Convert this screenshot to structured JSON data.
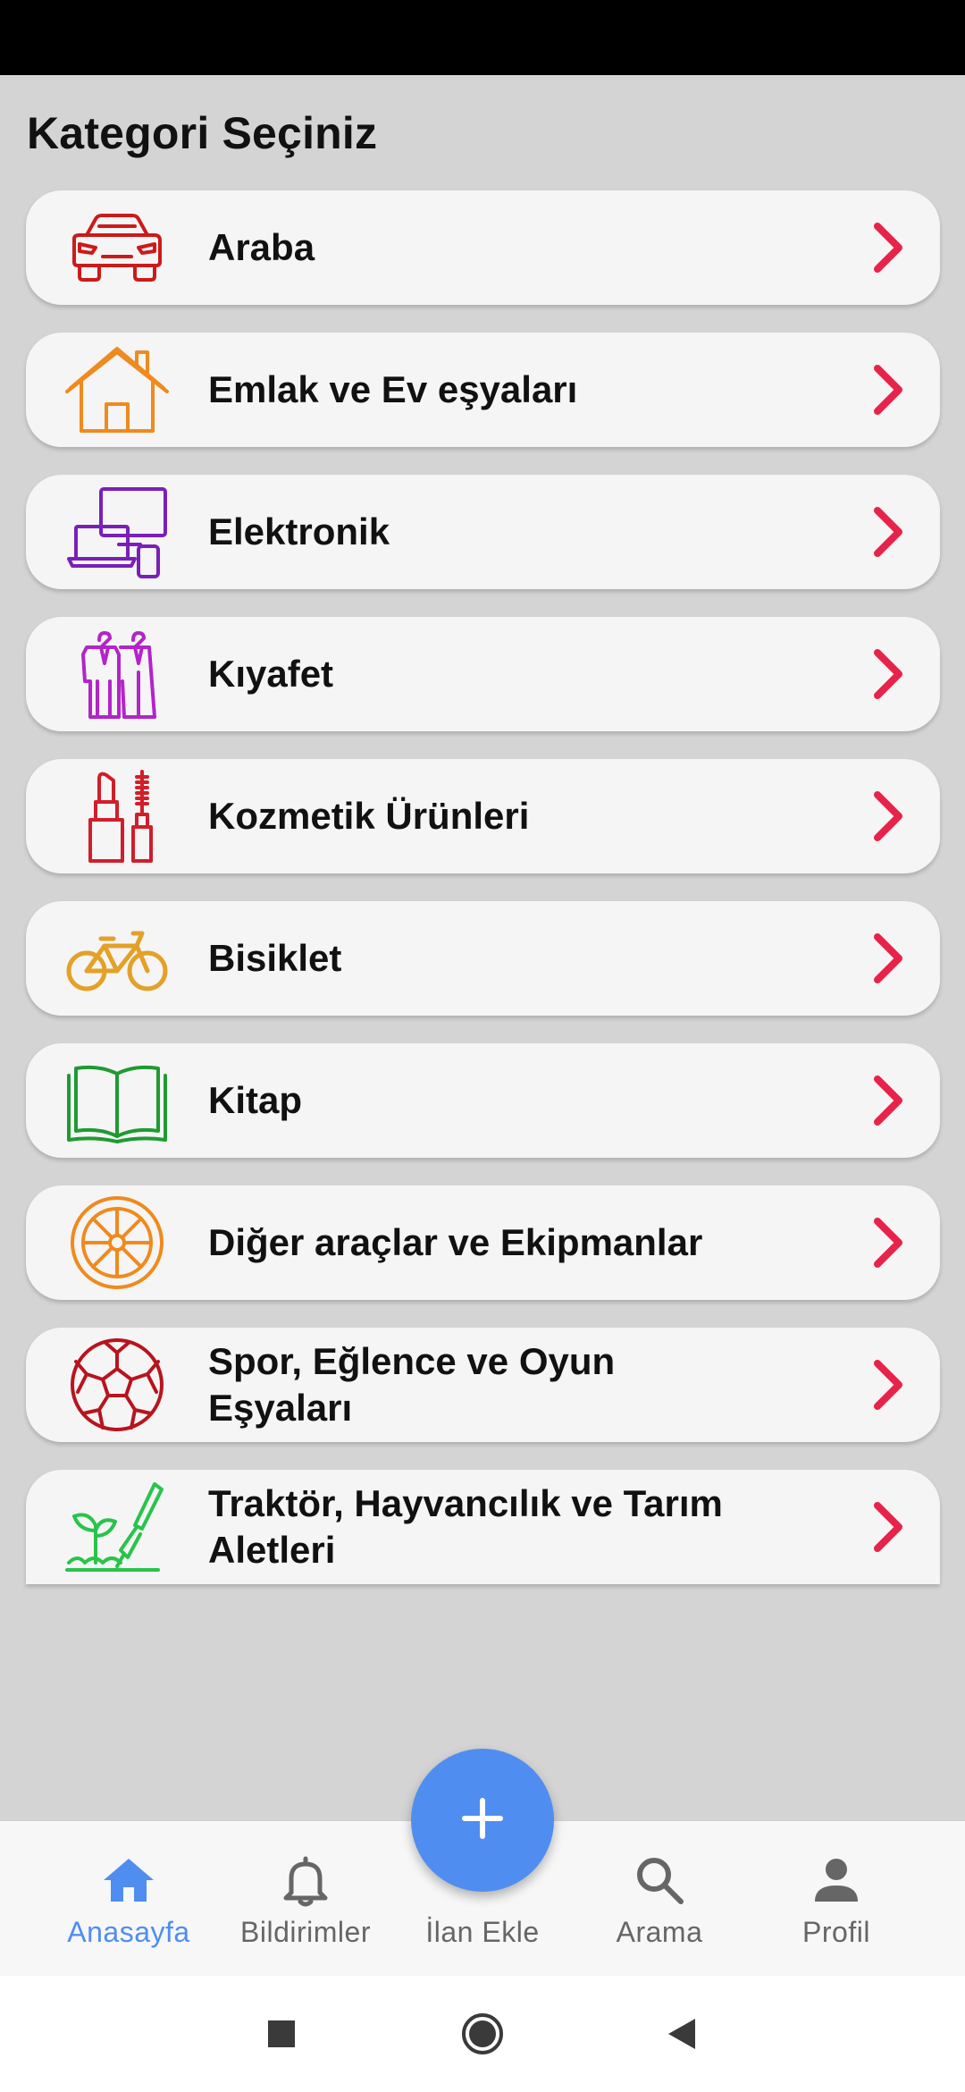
{
  "page": {
    "title": "Kategori Seçiniz"
  },
  "colors": {
    "chevron": "#e8234a",
    "accent": "#4f8ef0",
    "inactive": "#666666"
  },
  "categories": [
    {
      "label": "Araba",
      "icon": "car-icon",
      "color": "#cc1a1a"
    },
    {
      "label": "Emlak ve Ev eşyaları",
      "icon": "house-icon",
      "color": "#ef8a1e"
    },
    {
      "label": "Elektronik",
      "icon": "devices-icon",
      "color": "#7a1fb8"
    },
    {
      "label": "Kıyafet",
      "icon": "clothes-icon",
      "color": "#b324c9"
    },
    {
      "label": "Kozmetik Ürünleri",
      "icon": "cosmetics-icon",
      "color": "#d21e2a"
    },
    {
      "label": "Bisiklet",
      "icon": "bicycle-icon",
      "color": "#e3a128"
    },
    {
      "label": "Kitap",
      "icon": "book-icon",
      "color": "#1f9a32"
    },
    {
      "label": "Diğer araçlar ve Ekipmanlar",
      "icon": "wheel-icon",
      "color": "#ef8a1e"
    },
    {
      "label": "Spor, Eğlence ve Oyun Eşyaları",
      "icon": "football-icon",
      "color": "#b8141e"
    },
    {
      "label": "Traktör, Hayvancılık ve Tarım Aletleri",
      "icon": "garden-tools-icon",
      "color": "#28c44a"
    }
  ],
  "fab": {
    "icon": "plus-icon"
  },
  "bottom_nav": [
    {
      "label": "Anasayfa",
      "icon": "home-icon",
      "active": true
    },
    {
      "label": "Bildirimler",
      "icon": "bell-icon",
      "active": false
    },
    {
      "label": "İlan Ekle",
      "icon": "",
      "active": false
    },
    {
      "label": "Arama",
      "icon": "search-icon",
      "active": false
    },
    {
      "label": "Profil",
      "icon": "person-icon",
      "active": false
    }
  ],
  "system_nav": [
    "recents-button",
    "home-button",
    "back-button"
  ]
}
